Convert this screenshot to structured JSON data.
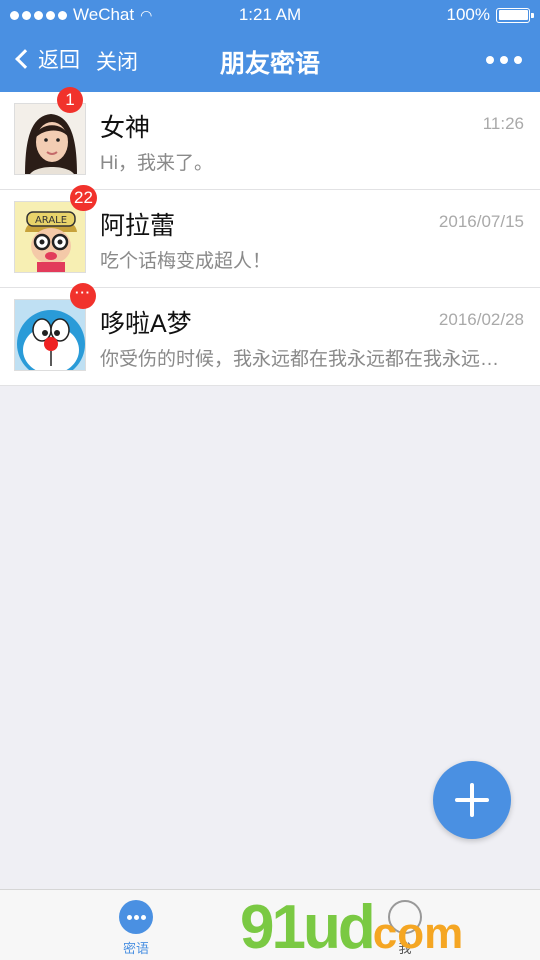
{
  "status": {
    "carrier": "WeChat",
    "time": "1:21 AM",
    "battery": "100%"
  },
  "nav": {
    "back_label": "返回",
    "close_label": "关闭",
    "title": "朋友密语"
  },
  "chats": [
    {
      "name": "女神",
      "time": "11:26",
      "message": "Hi，我来了。",
      "badge": "1"
    },
    {
      "name": "阿拉蕾",
      "time": "2016/07/15",
      "message": "吃个话梅变成超人！",
      "badge": "22"
    },
    {
      "name": "哆啦A梦",
      "time": "2016/02/28",
      "message": "你受伤的时候，我永远都在我永远都在我永远都在",
      "badge": "···"
    }
  ],
  "tabs": [
    {
      "label": "密语"
    },
    {
      "label": "我"
    }
  ],
  "watermark": {
    "main": "91ud",
    "suffix": "com"
  },
  "colors": {
    "accent": "#4a90e2",
    "badge": "#f1322c"
  }
}
